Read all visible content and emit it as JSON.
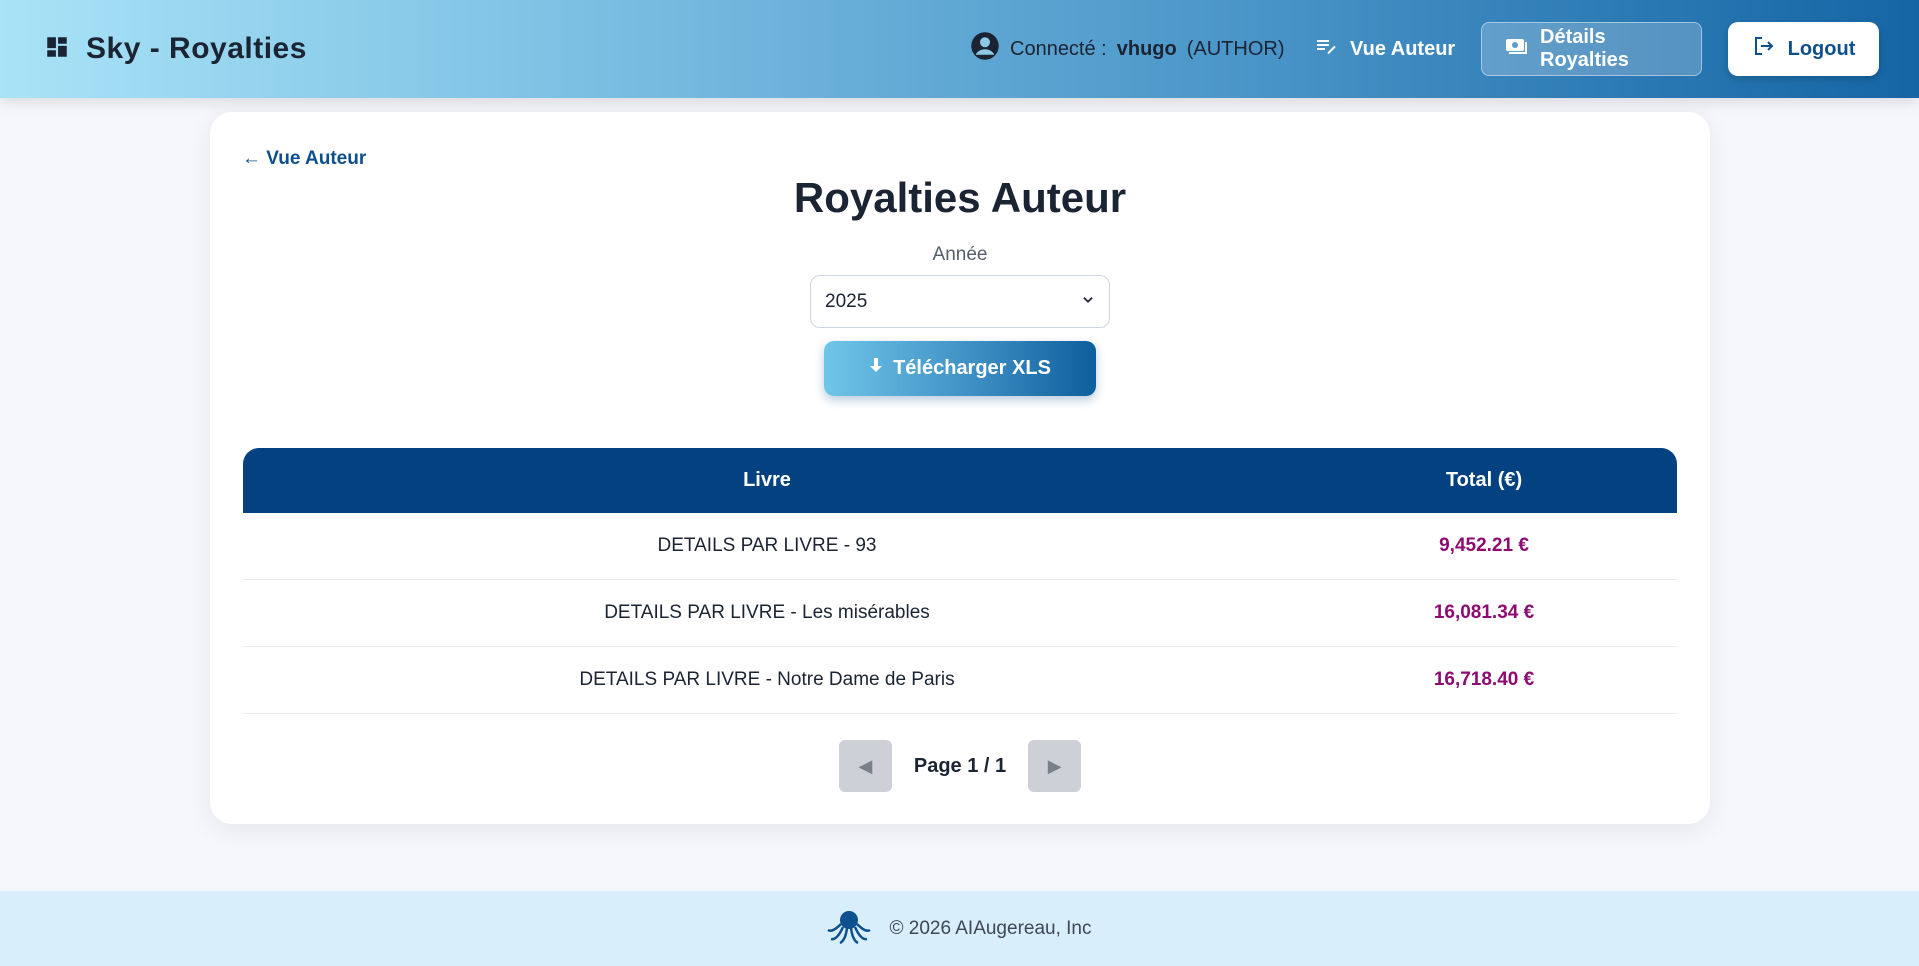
{
  "header": {
    "brand_title": "Sky - Royalties",
    "user_prefix": "Connecté :",
    "user_name": "vhugo",
    "user_role": "(AUTHOR)",
    "nav_vue_auteur": "Vue Auteur",
    "nav_details": "Détails Royalties",
    "logout": "Logout"
  },
  "main": {
    "back_link": "← Vue Auteur",
    "title": "Royalties Auteur",
    "year_label": "Année",
    "year_selected": "2025",
    "download_label": "Télécharger XLS",
    "table": {
      "headers": [
        "Livre",
        "Total (€)"
      ],
      "rows": [
        {
          "book": "DETAILS PAR LIVRE - 93",
          "total": "9,452.21 €"
        },
        {
          "book": "DETAILS PAR LIVRE - Les misérables",
          "total": "16,081.34 €"
        },
        {
          "book": "DETAILS PAR LIVRE - Notre Dame de Paris",
          "total": "16,718.40 €"
        }
      ]
    },
    "pager": {
      "text": "Page 1 / 1"
    }
  },
  "footer": {
    "copyright": "© 2026 AIAugereau, Inc"
  },
  "icons": [
    "dashboard-icon",
    "account-circle-icon",
    "edit-note-icon",
    "payments-icon",
    "logout-icon",
    "download-icon",
    "chevron-down-icon",
    "prev-arrow-icon",
    "next-arrow-icon",
    "octopus-logo-icon"
  ],
  "colors": {
    "primary": "#044181",
    "amount": "#8e0b73",
    "link": "#0e4f8d",
    "footer_bg": "#d8effb"
  }
}
